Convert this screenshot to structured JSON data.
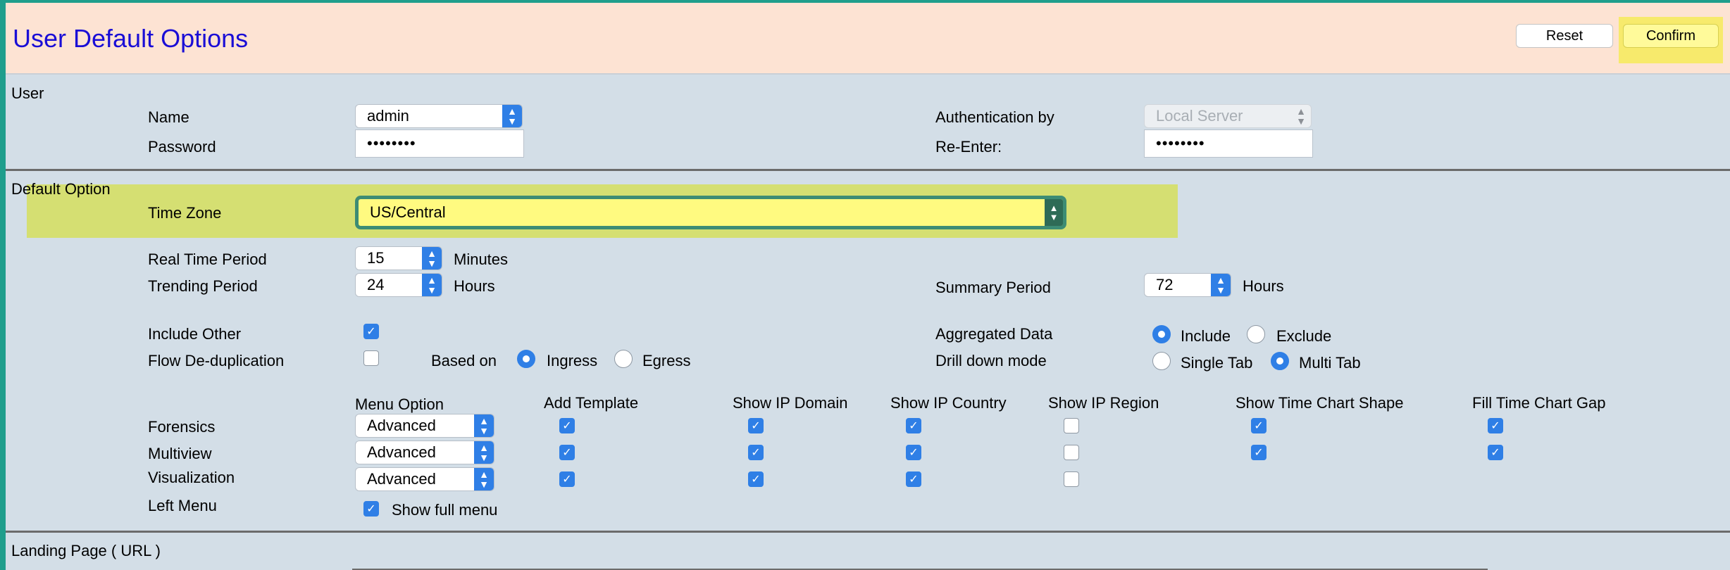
{
  "header": {
    "title": "User Default Options",
    "reset_label": "Reset",
    "confirm_label": "Confirm"
  },
  "user_section": {
    "label": "User",
    "name_label": "Name",
    "name_value": "admin",
    "password_label": "Password",
    "password_value": "••••••••",
    "auth_label": "Authentication by",
    "auth_value": "Local Server",
    "reenter_label": "Re-Enter:",
    "reenter_value": "••••••••"
  },
  "default_section": {
    "label": "Default Option",
    "timezone_label": "Time Zone",
    "timezone_value": "US/Central",
    "realtime_label": "Real Time Period",
    "realtime_value": "15",
    "realtime_unit": "Minutes",
    "trending_label": "Trending Period",
    "trending_value": "24",
    "trending_unit": "Hours",
    "summary_label": "Summary Period",
    "summary_value": "72",
    "summary_unit": "Hours",
    "include_other_label": "Include Other",
    "include_other_checked": true,
    "flow_dedup_label": "Flow De-duplication",
    "flow_dedup_checked": false,
    "based_on_label": "Based on",
    "based_on_options": [
      "Ingress",
      "Egress"
    ],
    "based_on_selected": "Ingress",
    "aggregated_label": "Aggregated Data",
    "aggregated_options": [
      "Include",
      "Exclude"
    ],
    "aggregated_selected": "Include",
    "drill_label": "Drill down mode",
    "drill_options": [
      "Single Tab",
      "Multi Tab"
    ],
    "drill_selected": "Multi Tab"
  },
  "menu_table": {
    "columns": [
      "Menu Option",
      "Add Template",
      "Show IP Domain",
      "Show IP Country",
      "Show IP Region",
      "Show Time Chart Shape",
      "Fill Time Chart Gap"
    ],
    "rows": [
      {
        "label": "Forensics",
        "menu_option": "Advanced",
        "checks": [
          true,
          true,
          true,
          false,
          true,
          true
        ]
      },
      {
        "label": "Multiview",
        "menu_option": "Advanced",
        "checks": [
          true,
          true,
          true,
          false,
          true,
          true
        ]
      },
      {
        "label": "Visualization",
        "menu_option": "Advanced",
        "checks": [
          true,
          true,
          true,
          false
        ]
      }
    ],
    "left_menu_label": "Left Menu",
    "show_full_menu_label": "Show full menu",
    "show_full_menu_checked": true
  },
  "landing_section": {
    "label": "Landing Page ( URL )"
  },
  "colors": {
    "header_bg": "#fde3d3",
    "page_bg": "#d3dee7",
    "title": "#1a0dd6",
    "accent": "#2f7fe6",
    "highlight_yellow": "#fffa80"
  }
}
